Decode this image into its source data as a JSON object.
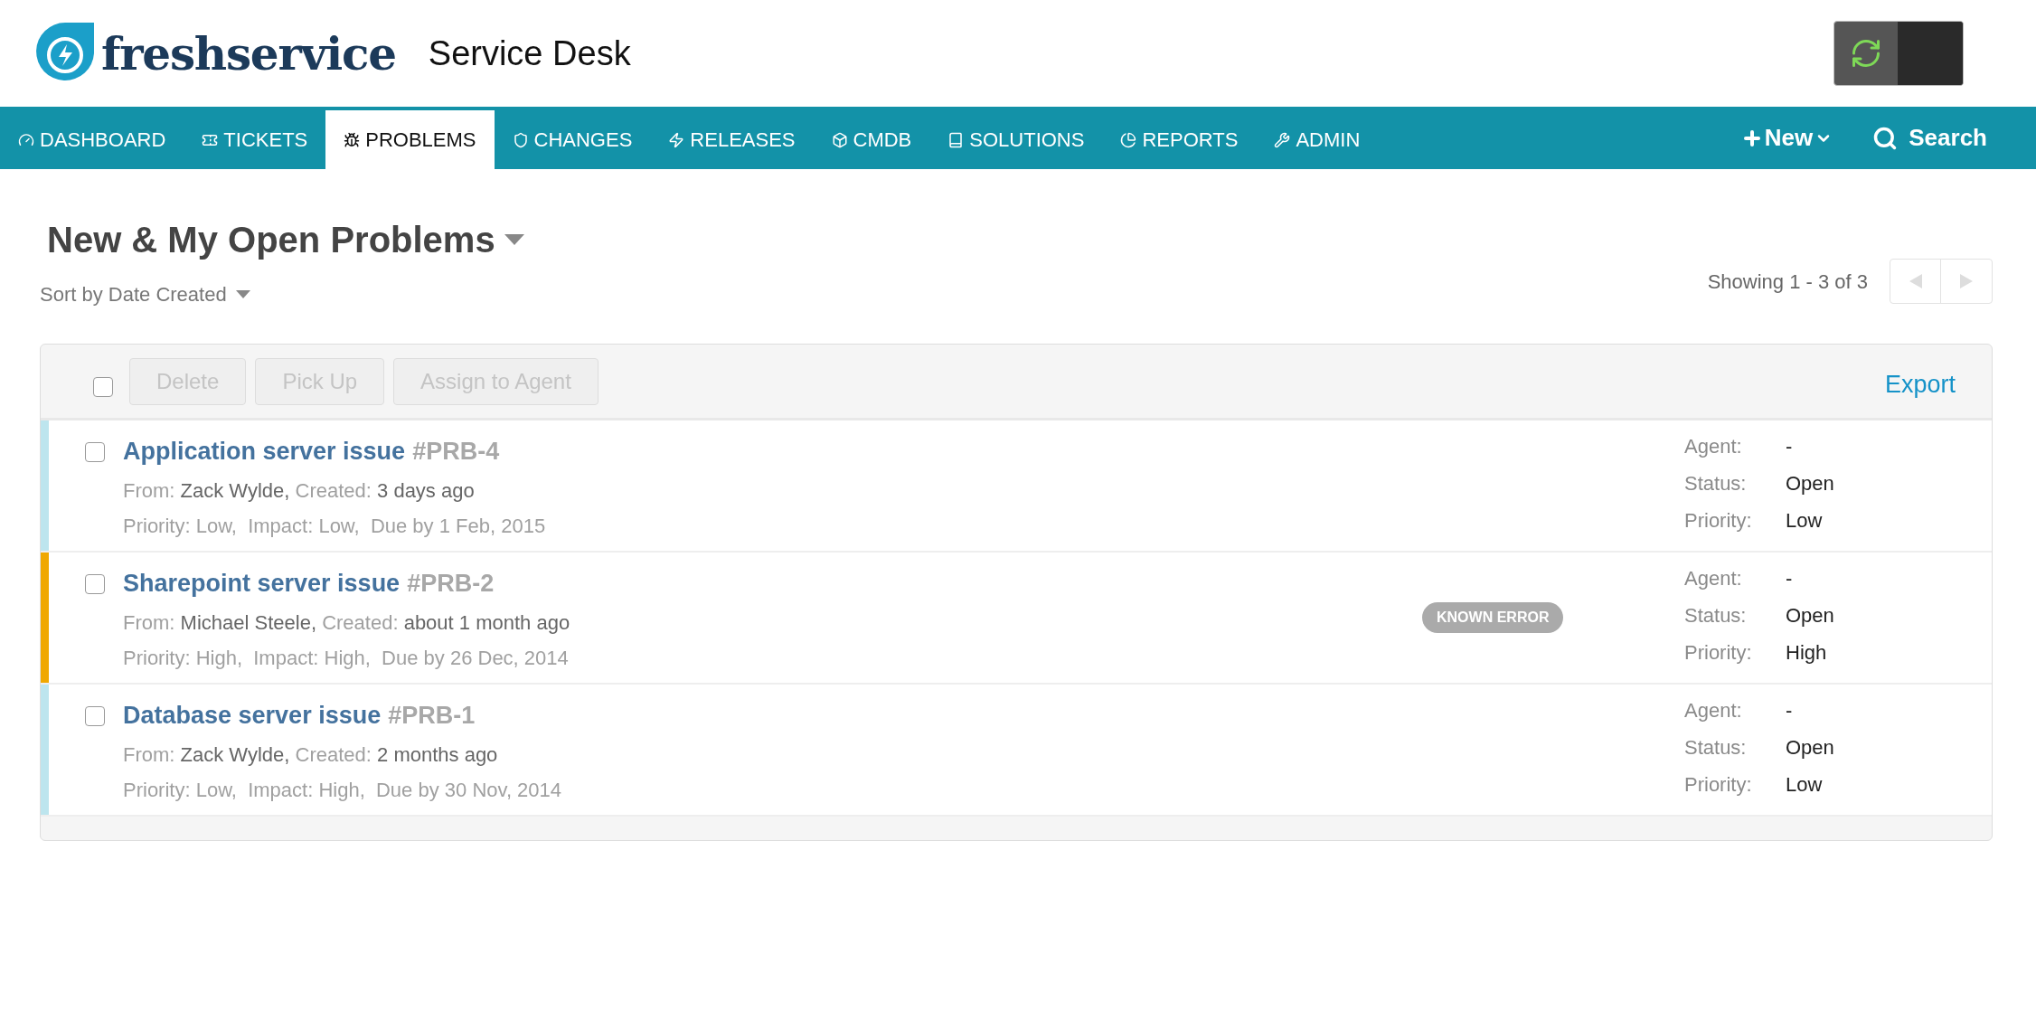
{
  "header": {
    "brand": "freshservice",
    "title": "Service Desk"
  },
  "nav": {
    "items": [
      {
        "label": "DASHBOARD",
        "selected": false
      },
      {
        "label": "TICKETS",
        "selected": false
      },
      {
        "label": "PROBLEMS",
        "selected": true
      },
      {
        "label": "CHANGES",
        "selected": false
      },
      {
        "label": "RELEASES",
        "selected": false
      },
      {
        "label": "CMDB",
        "selected": false
      },
      {
        "label": "SOLUTIONS",
        "selected": false
      },
      {
        "label": "REPORTS",
        "selected": false
      },
      {
        "label": "ADMIN",
        "selected": false
      }
    ],
    "new_label": "New",
    "search_label": "Search"
  },
  "view": {
    "title": "New & My Open Problems",
    "sort": "Sort by Date Created",
    "showing": "Showing 1 - 3 of 3"
  },
  "toolbar": {
    "select_all_checked": false,
    "buttons": [
      {
        "label": "Delete",
        "disabled": true
      },
      {
        "label": "Pick Up",
        "disabled": true
      },
      {
        "label": "Assign to Agent",
        "disabled": true
      }
    ],
    "export": "Export"
  },
  "problems": [
    {
      "title": "Application server issue",
      "id": "#PRB-4",
      "color": "#bde5ee",
      "checked": false,
      "from_label": "From:",
      "from": "Zack Wylde,",
      "created_label": "Created:",
      "created": "3 days ago",
      "details": "Priority: Low,  Impact: Low,  Due by 1 Feb, 2015",
      "agent_label": "Agent:",
      "agent": "-",
      "status_label": "Status:",
      "status": "Open",
      "priority_label": "Priority:",
      "priority": "Low"
    },
    {
      "title": "Sharepoint server issue",
      "id": "#PRB-2",
      "color": "#f0a800",
      "checked": false,
      "from_label": "From:",
      "from": "Michael Steele,",
      "created_label": "Created:",
      "created": "about 1 month ago",
      "details": "Priority: High,  Impact: High,  Due by 26 Dec, 2014",
      "badge": "KNOWN ERROR",
      "agent_label": "Agent:",
      "agent": "-",
      "status_label": "Status:",
      "status": "Open",
      "priority_label": "Priority:",
      "priority": "High"
    },
    {
      "title": "Database server issue",
      "id": "#PRB-1",
      "color": "#bde5ee",
      "checked": false,
      "from_label": "From:",
      "from": "Zack Wylde,",
      "created_label": "Created:",
      "created": "2 months ago",
      "details": "Priority: Low,  Impact: High,  Due by 30 Nov, 2014",
      "agent_label": "Agent:",
      "agent": "-",
      "status_label": "Status:",
      "status": "Open",
      "priority_label": "Priority:",
      "priority": "Low"
    }
  ]
}
